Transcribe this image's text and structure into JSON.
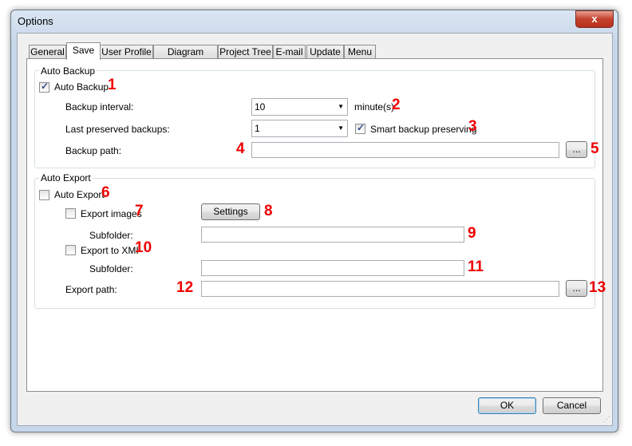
{
  "window": {
    "title": "Options",
    "close_label": "x"
  },
  "tabs": [
    {
      "label": "General"
    },
    {
      "label": "Save",
      "selected": true
    },
    {
      "label": "User Profile"
    },
    {
      "label": "Diagram Editor"
    },
    {
      "label": "Project Tree"
    },
    {
      "label": "E-mail"
    },
    {
      "label": "Update"
    },
    {
      "label": "Menu"
    }
  ],
  "auto_backup": {
    "group_label": "Auto Backup",
    "checkbox_label": "Auto Backup",
    "checked": true,
    "interval_label": "Backup interval:",
    "interval_value": "10",
    "interval_unit": "minute(s)",
    "preserved_label": "Last preserved backups:",
    "preserved_value": "1",
    "smart_label": "Smart backup preserving",
    "smart_checked": true,
    "path_label": "Backup path:",
    "path_value": "",
    "browse_label": "..."
  },
  "auto_export": {
    "group_label": "Auto Export",
    "checkbox_label": "Auto Export",
    "checked": false,
    "images_label": "Export images",
    "images_checked": false,
    "settings_label": "Settings",
    "images_subfolder_label": "Subfolder:",
    "images_subfolder_value": "",
    "xmi_label": "Export to XMI",
    "xmi_checked": false,
    "xmi_subfolder_label": "Subfolder:",
    "xmi_subfolder_value": "",
    "path_label": "Export path:",
    "path_value": "",
    "browse_label": "..."
  },
  "annotations": [
    "1",
    "2",
    "3",
    "4",
    "5",
    "6",
    "7",
    "8",
    "9",
    "10",
    "11",
    "12",
    "13"
  ],
  "footer": {
    "ok_label": "OK",
    "cancel_label": "Cancel"
  },
  "colors": {
    "annotation": "#ee0000",
    "frame": "#c7d7ea"
  }
}
